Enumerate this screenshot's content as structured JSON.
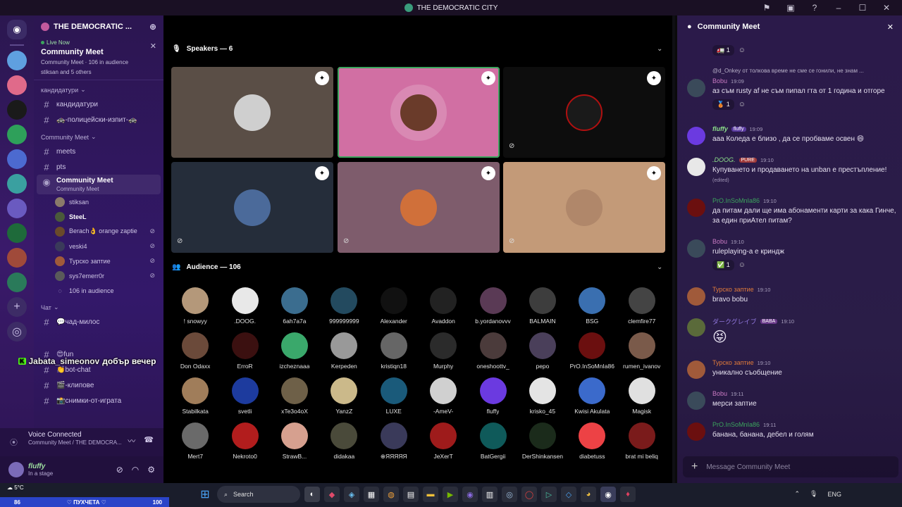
{
  "titlebar": {
    "title": "THE DEMOCRATIC CITY"
  },
  "server": {
    "name": "THE DEMOCRATIC ...",
    "live": {
      "tag": "Live Now",
      "name": "Community Meet",
      "meta": "Community Meet · 106 in audience",
      "who": "stiksan and 5 others"
    },
    "categories": [
      {
        "name": "кандидатури",
        "channels": [
          "кандидатури",
          "🚓-полицейски-изпит-🚓"
        ]
      },
      {
        "name": "Community Meet",
        "channels": [
          "meets",
          "pts"
        ]
      }
    ],
    "active_stage": {
      "name": "Community Meet",
      "sub": "Community Meet"
    },
    "members": [
      "stiksan",
      "SteeL",
      "Berach👌 orange zaptie",
      "veski4",
      "Турско заптие",
      "sys7emerr0r",
      "106 in audience"
    ],
    "chat_category": "Чат",
    "chat_channels": [
      "💬чад-милос",
      "😍fun",
      "👏bot-chat",
      "🎬-клипове",
      "📸снимки-от-играта"
    ]
  },
  "overlay": {
    "user": "Jabata_simeonov",
    "text": "добър вечер"
  },
  "voice": {
    "status": "Voice Connected",
    "sub": "Community Meet / THE DEMOCRA..."
  },
  "user": {
    "name": "fluffy",
    "status": "In a stage"
  },
  "stage": {
    "speakers_header": "Speakers — 6",
    "audience_header": "Audience — 106",
    "speaker_colors": [
      "#5a4e46",
      "#d16fa3",
      "#0d0d0d",
      "#252d3a",
      "#7e5c6c",
      "#c39a78"
    ],
    "audience": [
      "! snowyy",
      ".DOOG.",
      "6ah7a7a",
      "999999999",
      "Alexander",
      "Avaddon",
      "b.yordanovvv",
      "BALMAIN",
      "BSG",
      "clemfire77",
      "Don Odaxx",
      "ErroR",
      "izcheznaaa",
      "Kerpeden",
      "kristiqn18",
      "Murphy",
      "oneshoottv_",
      "pepo",
      "PrO.InSoMnIa86",
      "rumen_ivanov",
      "Stabilkata",
      "svetli",
      "xTe3o4oX",
      "YanzZ",
      "LUXE",
      "-AmeV-",
      "fluffy",
      "krisko_45",
      "Kwisi Akulata",
      "Magisk",
      "Mert7",
      "Nekroto0",
      "StrawB...",
      "didakaa",
      "⊕ЯЯЯЯЯ",
      "JeXerT",
      "BatGergii",
      "DerShinkansen",
      "diabetuss",
      "brat mi beliq"
    ],
    "audience_colors": [
      "#b4987a",
      "#e8e8e8",
      "#3b6d8f",
      "#234a5f",
      "#111",
      "#222",
      "#5a3a55",
      "#3d3d3d",
      "#3a6fb0",
      "#444",
      "#6b4a3a",
      "#3b1010",
      "#3aa86b",
      "#999",
      "#666",
      "#2b2b2b",
      "#4b3b3b",
      "#4a3f5a",
      "#6b0f0f",
      "#7a5a4a",
      "#a07d5a",
      "#1d3b9e",
      "#6e6048",
      "#cbb98a",
      "#1a5a7a",
      "#d0d0d0",
      "#6b3ae0",
      "#e4e4e4",
      "#3b6acb",
      "#e0e0e0",
      "#6a6a6a",
      "#b21d1d",
      "#d6a08f",
      "#4a4a3a",
      "#3a3a5a",
      "#9e1b1b",
      "#0f5a5a",
      "#1b2b1b",
      "#ed4245",
      "#7a1b1b"
    ]
  },
  "chat": {
    "title": "Community Meet",
    "messages": [
      {
        "reaction": "🚛 1"
      },
      {
        "reply": "@d_Onkey от толкова време не сме се гонили, не знам ...",
        "user": "Bobu",
        "time": "19:09",
        "text": "аз съм rusty af не съм пипал гта от 1 година и отгоре",
        "reaction": "🥉 1",
        "color": "#c879c2"
      },
      {
        "user": "fluffy",
        "tag": "fluffy",
        "time": "19:09",
        "text": "ааа Коледа е близо , да се пробваме освен 😄",
        "color": "#8ce08a"
      },
      {
        "user": ".DOOG.",
        "tag": "PURE",
        "time": "19:10",
        "text": "Купуването и продаването на unban е престъпление!",
        "edited": "(edited)",
        "color": "#8ce08a"
      },
      {
        "user": "PrO.InSoMnIa86",
        "time": "19:10",
        "text": "да питам дали ще има абонаменти карти за кака Гинче, за един приАтел питам?",
        "color": "#3ba55d"
      },
      {
        "user": "Bobu",
        "time": "19:10",
        "text": "ruleplaying-а е криндж",
        "reaction": "✅ 1",
        "color": "#c879c2"
      },
      {
        "user": "Турско заптие",
        "time": "19:10",
        "text": "bravo bobu",
        "color": "#e07a3a"
      },
      {
        "user": "ダークグレイブ",
        "tag": "BABA",
        "time": "19:10",
        "text": "😝",
        "color": "#8e75d9"
      },
      {
        "user": "Турско заптие",
        "time": "19:10",
        "text": "уникално съобщение",
        "color": "#e07a3a"
      },
      {
        "user": "Bobu",
        "time": "19:11",
        "text": "мерси заптие",
        "color": "#c879c2"
      },
      {
        "user": "PrO.InSoMnIa86",
        "time": "19:11",
        "text": "банана, банана, дебел и голям",
        "color": "#3ba55d"
      }
    ],
    "composer_placeholder": "Message Community Meet"
  },
  "taskbar": {
    "weather": "5°C",
    "stream_left": "86",
    "stream_center": "♡ ПУХЧЕТА ♡",
    "stream_right": "100",
    "search_label": "Search",
    "lang": "ENG"
  }
}
